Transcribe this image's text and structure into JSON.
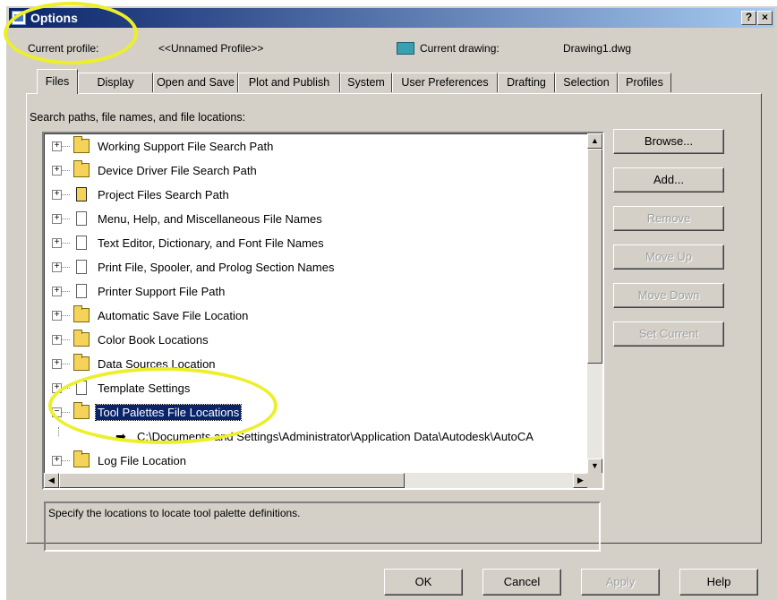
{
  "window": {
    "title": "Options",
    "help_label": "?",
    "close_label": "×"
  },
  "profile": {
    "current_profile_label": "Current profile:",
    "current_profile_value": "<<Unnamed Profile>>",
    "current_drawing_label": "Current drawing:",
    "current_drawing_value": "Drawing1.dwg"
  },
  "tabs": [
    "Files",
    "Display",
    "Open and Save",
    "Plot and Publish",
    "System",
    "User Preferences",
    "Drafting",
    "Selection",
    "Profiles"
  ],
  "panel": {
    "label": "Search paths, file names, and file locations:"
  },
  "tree": [
    {
      "label": "Working Support File Search Path",
      "icon": "folder-icon",
      "expander": "+"
    },
    {
      "label": "Device Driver File Search Path",
      "icon": "folder-icon",
      "expander": "+"
    },
    {
      "label": "Project Files Search Path",
      "icon": "project-icon",
      "expander": "+"
    },
    {
      "label": "Menu, Help, and Miscellaneous File Names",
      "icon": "document-icon",
      "expander": "+"
    },
    {
      "label": "Text Editor, Dictionary, and Font File Names",
      "icon": "document-icon",
      "expander": "+"
    },
    {
      "label": "Print File, Spooler, and Prolog Section Names",
      "icon": "document-icon",
      "expander": "+"
    },
    {
      "label": "Printer Support File Path",
      "icon": "document-icon",
      "expander": "+"
    },
    {
      "label": "Automatic Save File Location",
      "icon": "folder-icon",
      "expander": "+"
    },
    {
      "label": "Color Book Locations",
      "icon": "folder-icon",
      "expander": "+"
    },
    {
      "label": "Data Sources Location",
      "icon": "folder-icon",
      "expander": "+"
    },
    {
      "label": "Template Settings",
      "icon": "document-icon",
      "expander": "+"
    },
    {
      "label": "Tool Palettes File Locations",
      "icon": "folder-open-icon",
      "expander": "−",
      "selected": true
    },
    {
      "label": "C:\\Documents and Settings\\Administrator\\Application Data\\Autodesk\\AutoCA",
      "icon": "path-arrow-icon",
      "child": true
    },
    {
      "label": "Log File Location",
      "icon": "folder-icon",
      "expander": "+"
    }
  ],
  "buttons": {
    "browse": "Browse...",
    "add": "Add...",
    "remove": "Remove",
    "move_up": "Move Up",
    "move_down": "Move Down",
    "set_current": "Set Current"
  },
  "description": "Specify the locations to locate tool palette definitions.",
  "bottom": {
    "ok": "OK",
    "cancel": "Cancel",
    "apply": "Apply",
    "help": "Help"
  },
  "colors": {
    "titlebar": "#0a246a",
    "highlight": "#ecef2a",
    "selection": "#0a246a"
  }
}
